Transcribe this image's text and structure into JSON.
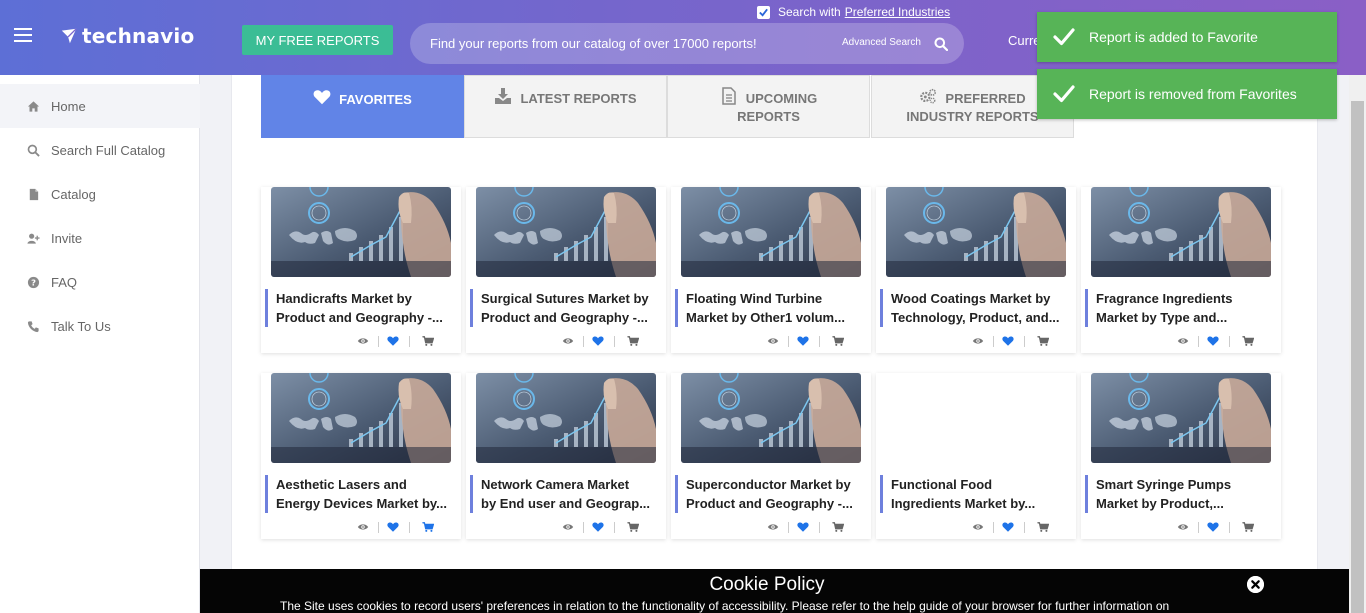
{
  "header": {
    "logo_text": "technavio",
    "free_reports_label": "MY FREE REPORTS",
    "preferred_prefix": "Search with",
    "preferred_link": "Preferred Industries",
    "search_placeholder": "Find your reports from our catalog of over 17000 reports!",
    "advanced_search_label": "Advanced Search",
    "currency_text": "Curre"
  },
  "toasts": [
    {
      "message": "Report is added to Favorite"
    },
    {
      "message": "Report is removed from Favorites"
    }
  ],
  "sidebar": {
    "items": [
      {
        "label": "Home",
        "icon": "home-icon"
      },
      {
        "label": "Search Full Catalog",
        "icon": "search-icon"
      },
      {
        "label": "Catalog",
        "icon": "file-icon"
      },
      {
        "label": "Invite",
        "icon": "add-user-icon"
      },
      {
        "label": "FAQ",
        "icon": "question-icon"
      },
      {
        "label": "Talk To Us",
        "icon": "phone-icon"
      }
    ]
  },
  "tabs": [
    {
      "line1": "FAVORITES",
      "line2": "",
      "icon": "heart-icon",
      "active": true
    },
    {
      "line1": "LATEST REPORTS",
      "line2": "",
      "icon": "download-icon",
      "active": false
    },
    {
      "line1": "UPCOMING",
      "line2": "REPORTS",
      "icon": "document-icon",
      "active": false
    },
    {
      "line1": "PREFERRED",
      "line2": "INDUSTRY REPORTS",
      "icon": "gears-icon",
      "active": false
    }
  ],
  "cards": [
    {
      "line1": "Handicrafts Market by",
      "line2": "Product and Geography -...",
      "has_image": true,
      "cart_highlight": false
    },
    {
      "line1": "Surgical Sutures Market by",
      "line2": "Product and Geography -...",
      "has_image": true,
      "cart_highlight": false
    },
    {
      "line1": "Floating Wind Turbine",
      "line2": "Market by Other1 volum...",
      "has_image": true,
      "cart_highlight": false
    },
    {
      "line1": "Wood Coatings Market by",
      "line2": "Technology, Product, and...",
      "has_image": true,
      "cart_highlight": false
    },
    {
      "line1": "Fragrance Ingredients",
      "line2": "Market by Type and...",
      "has_image": true,
      "cart_highlight": false
    },
    {
      "line1": "Aesthetic Lasers and",
      "line2": "Energy Devices Market by...",
      "has_image": true,
      "cart_highlight": true
    },
    {
      "line1": "Network Camera Market",
      "line2": "by End user and Geograp...",
      "has_image": true,
      "cart_highlight": false
    },
    {
      "line1": "Superconductor Market by",
      "line2": "Product and Geography -...",
      "has_image": true,
      "cart_highlight": false
    },
    {
      "line1": "Functional Food",
      "line2": "Ingredients Market by...",
      "has_image": false,
      "cart_highlight": false
    },
    {
      "line1": "Smart Syringe Pumps",
      "line2": "Market by Product,...",
      "has_image": true,
      "cart_highlight": false
    }
  ],
  "cookie": {
    "title": "Cookie Policy",
    "text": "The Site uses cookies to record users' preferences in relation to the functionality of accessibility. Please refer to the help guide of your browser for further information on"
  },
  "colors": {
    "header_start": "#5d6fd6",
    "header_end": "#8a5fc6",
    "free_button": "#3bbd95",
    "toast": "#57b457",
    "active_tab": "#6184e7",
    "heart": "#1e73e8"
  }
}
